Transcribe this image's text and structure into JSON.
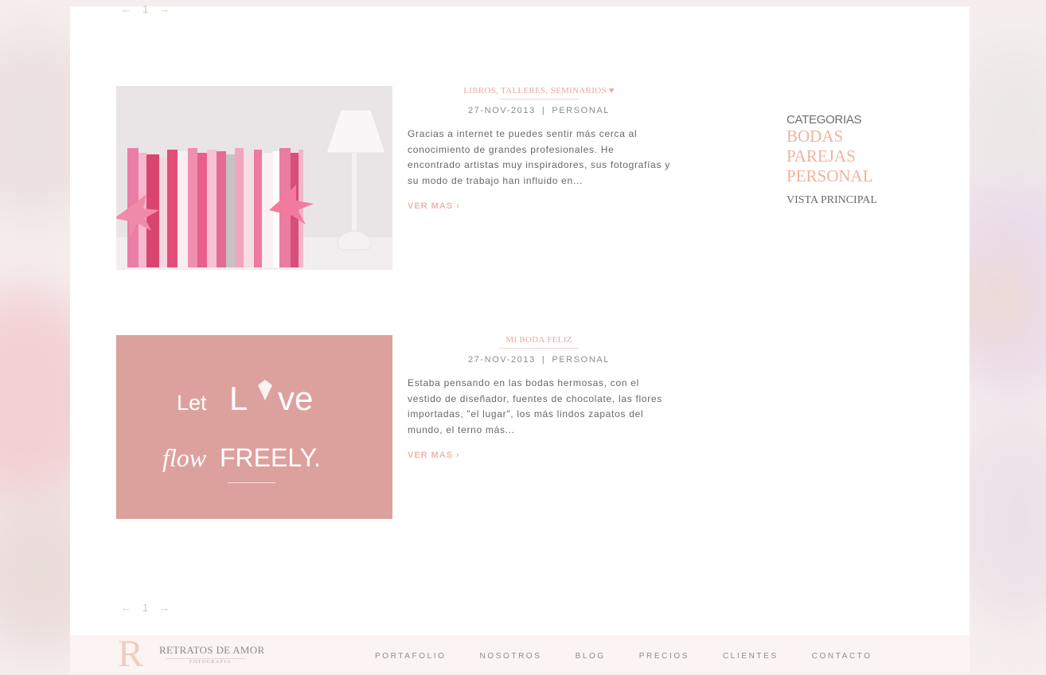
{
  "pagination": {
    "prev": "←",
    "page": "1",
    "next": "→"
  },
  "posts": [
    {
      "title": "LIBROS, TALLERES, SEMINARIOS ♥",
      "date": "27-NOV-2013",
      "separator": "|",
      "category": "PERSONAL",
      "excerpt": "Gracias a internet te puedes sentir más cerca al conocimiento de grandes profesionales. He encontrado artistas muy inspiradores, sus fotografías y su modo de trabajo han influido en...",
      "read_more": "VER MAS ›"
    },
    {
      "title": "MI BODA FELIZ",
      "date": "27-NOV-2013",
      "separator": "|",
      "category": "PERSONAL",
      "excerpt": "Estaba pensando en las bodas hermosas, con el vestido de diseñador, fuentes de chocolate, las flores importadas, \"el lugar\", los más lindos zapatos del mundo, el terno más...",
      "read_more": "VER MAS ›",
      "image_text": {
        "let": "Let",
        "love_l": "L",
        "love_ve": "ve",
        "flow": "flow",
        "freely": "FREELY."
      }
    }
  ],
  "sidebar": {
    "heading": "CATEGORIAS",
    "categories": [
      "BODAS",
      "PAREJAS",
      "PERSONAL"
    ],
    "main_link": "VISTA PRINCIPAL"
  },
  "footer": {
    "logo_letter": "R",
    "logo_name": "RETRATOS DE AMOR",
    "logo_sub": "FOTOGRAFIA",
    "nav": [
      "PORTAFOLIO",
      "NOSOTROS",
      "BLOG",
      "PRECIOS",
      "CLIENTES",
      "CONTACTO"
    ]
  },
  "colors": {
    "accent": "#efb5ad",
    "category_link": "#efb39f",
    "image2_bg": "#dda19d",
    "text": "#676767"
  }
}
